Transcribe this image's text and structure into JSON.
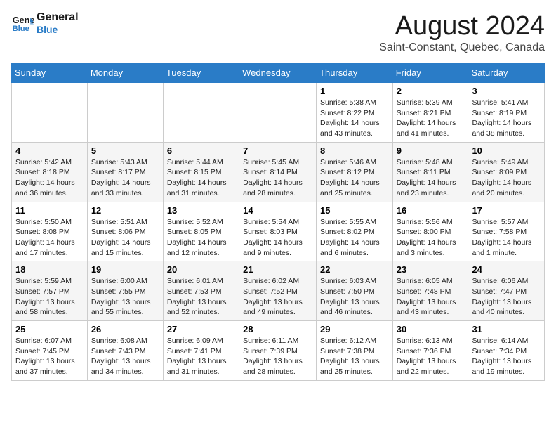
{
  "logo": {
    "line1": "General",
    "line2": "Blue"
  },
  "title": "August 2024",
  "subtitle": "Saint-Constant, Quebec, Canada",
  "days_of_week": [
    "Sunday",
    "Monday",
    "Tuesday",
    "Wednesday",
    "Thursday",
    "Friday",
    "Saturday"
  ],
  "weeks": [
    [
      {
        "day": "",
        "info": ""
      },
      {
        "day": "",
        "info": ""
      },
      {
        "day": "",
        "info": ""
      },
      {
        "day": "",
        "info": ""
      },
      {
        "day": "1",
        "info": "Sunrise: 5:38 AM\nSunset: 8:22 PM\nDaylight: 14 hours\nand 43 minutes."
      },
      {
        "day": "2",
        "info": "Sunrise: 5:39 AM\nSunset: 8:21 PM\nDaylight: 14 hours\nand 41 minutes."
      },
      {
        "day": "3",
        "info": "Sunrise: 5:41 AM\nSunset: 8:19 PM\nDaylight: 14 hours\nand 38 minutes."
      }
    ],
    [
      {
        "day": "4",
        "info": "Sunrise: 5:42 AM\nSunset: 8:18 PM\nDaylight: 14 hours\nand 36 minutes."
      },
      {
        "day": "5",
        "info": "Sunrise: 5:43 AM\nSunset: 8:17 PM\nDaylight: 14 hours\nand 33 minutes."
      },
      {
        "day": "6",
        "info": "Sunrise: 5:44 AM\nSunset: 8:15 PM\nDaylight: 14 hours\nand 31 minutes."
      },
      {
        "day": "7",
        "info": "Sunrise: 5:45 AM\nSunset: 8:14 PM\nDaylight: 14 hours\nand 28 minutes."
      },
      {
        "day": "8",
        "info": "Sunrise: 5:46 AM\nSunset: 8:12 PM\nDaylight: 14 hours\nand 25 minutes."
      },
      {
        "day": "9",
        "info": "Sunrise: 5:48 AM\nSunset: 8:11 PM\nDaylight: 14 hours\nand 23 minutes."
      },
      {
        "day": "10",
        "info": "Sunrise: 5:49 AM\nSunset: 8:09 PM\nDaylight: 14 hours\nand 20 minutes."
      }
    ],
    [
      {
        "day": "11",
        "info": "Sunrise: 5:50 AM\nSunset: 8:08 PM\nDaylight: 14 hours\nand 17 minutes."
      },
      {
        "day": "12",
        "info": "Sunrise: 5:51 AM\nSunset: 8:06 PM\nDaylight: 14 hours\nand 15 minutes."
      },
      {
        "day": "13",
        "info": "Sunrise: 5:52 AM\nSunset: 8:05 PM\nDaylight: 14 hours\nand 12 minutes."
      },
      {
        "day": "14",
        "info": "Sunrise: 5:54 AM\nSunset: 8:03 PM\nDaylight: 14 hours\nand 9 minutes."
      },
      {
        "day": "15",
        "info": "Sunrise: 5:55 AM\nSunset: 8:02 PM\nDaylight: 14 hours\nand 6 minutes."
      },
      {
        "day": "16",
        "info": "Sunrise: 5:56 AM\nSunset: 8:00 PM\nDaylight: 14 hours\nand 3 minutes."
      },
      {
        "day": "17",
        "info": "Sunrise: 5:57 AM\nSunset: 7:58 PM\nDaylight: 14 hours\nand 1 minute."
      }
    ],
    [
      {
        "day": "18",
        "info": "Sunrise: 5:59 AM\nSunset: 7:57 PM\nDaylight: 13 hours\nand 58 minutes."
      },
      {
        "day": "19",
        "info": "Sunrise: 6:00 AM\nSunset: 7:55 PM\nDaylight: 13 hours\nand 55 minutes."
      },
      {
        "day": "20",
        "info": "Sunrise: 6:01 AM\nSunset: 7:53 PM\nDaylight: 13 hours\nand 52 minutes."
      },
      {
        "day": "21",
        "info": "Sunrise: 6:02 AM\nSunset: 7:52 PM\nDaylight: 13 hours\nand 49 minutes."
      },
      {
        "day": "22",
        "info": "Sunrise: 6:03 AM\nSunset: 7:50 PM\nDaylight: 13 hours\nand 46 minutes."
      },
      {
        "day": "23",
        "info": "Sunrise: 6:05 AM\nSunset: 7:48 PM\nDaylight: 13 hours\nand 43 minutes."
      },
      {
        "day": "24",
        "info": "Sunrise: 6:06 AM\nSunset: 7:47 PM\nDaylight: 13 hours\nand 40 minutes."
      }
    ],
    [
      {
        "day": "25",
        "info": "Sunrise: 6:07 AM\nSunset: 7:45 PM\nDaylight: 13 hours\nand 37 minutes."
      },
      {
        "day": "26",
        "info": "Sunrise: 6:08 AM\nSunset: 7:43 PM\nDaylight: 13 hours\nand 34 minutes."
      },
      {
        "day": "27",
        "info": "Sunrise: 6:09 AM\nSunset: 7:41 PM\nDaylight: 13 hours\nand 31 minutes."
      },
      {
        "day": "28",
        "info": "Sunrise: 6:11 AM\nSunset: 7:39 PM\nDaylight: 13 hours\nand 28 minutes."
      },
      {
        "day": "29",
        "info": "Sunrise: 6:12 AM\nSunset: 7:38 PM\nDaylight: 13 hours\nand 25 minutes."
      },
      {
        "day": "30",
        "info": "Sunrise: 6:13 AM\nSunset: 7:36 PM\nDaylight: 13 hours\nand 22 minutes."
      },
      {
        "day": "31",
        "info": "Sunrise: 6:14 AM\nSunset: 7:34 PM\nDaylight: 13 hours\nand 19 minutes."
      }
    ]
  ]
}
